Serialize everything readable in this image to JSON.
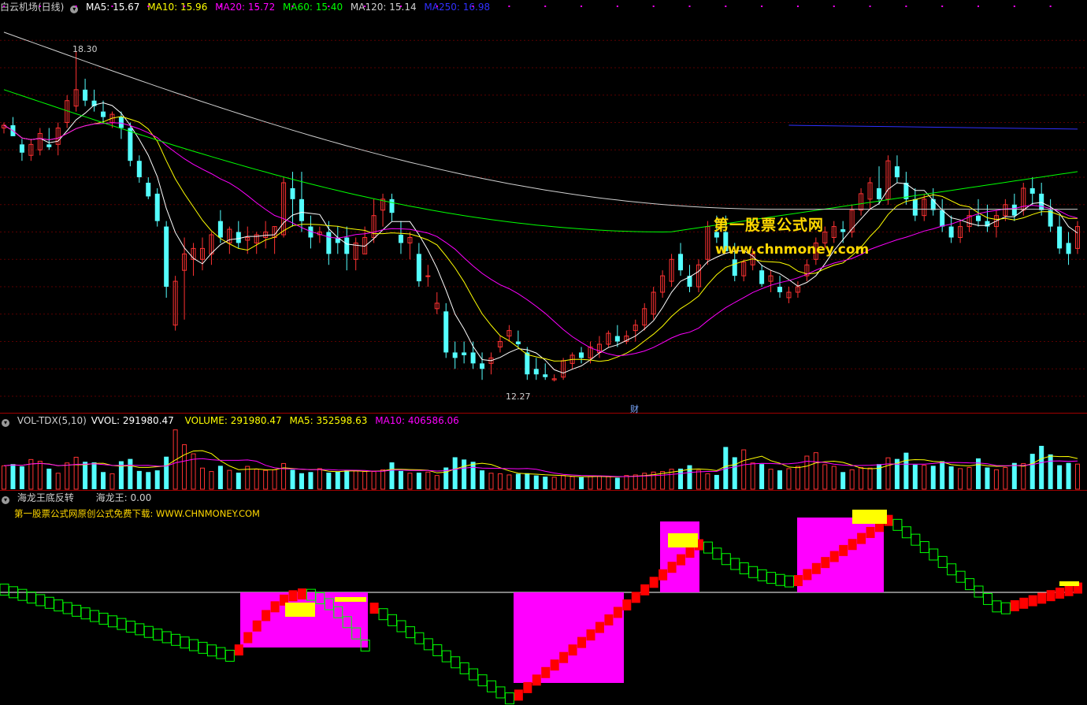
{
  "main_header": {
    "title": "白云机场(日线)",
    "ma5": "MA5: 15.67",
    "ma10": "MA10: 15.96",
    "ma20": "MA20: 15.72",
    "ma60": "MA60: 15.40",
    "ma120": "MA120: 15.14",
    "ma250": "MA250: 16.98"
  },
  "vol_header": {
    "name": "VOL-TDX(5,10)",
    "vvol": "VVOL: 291980.47",
    "volume": "VOLUME: 291980.47",
    "ma5": "MA5: 352598.63",
    "ma10": "MA10: 406586.06"
  },
  "ind_header": {
    "name": "海龙王底反转",
    "value": "海龙王: 0.00",
    "note": "第一股票公式网原创公式免费下载: WWW.CHNMONEY.COM"
  },
  "watermark": {
    "line1": "第一股票公式网",
    "line2": "www.chnmoney.com"
  },
  "annotations": {
    "high": "18.30",
    "low": "12.27",
    "finance_marker": "财"
  },
  "colors": {
    "up": "#ff3232",
    "down": "#54ffff",
    "ma5": "#ffffff",
    "ma10": "#ffff00",
    "ma20": "#ff00ff",
    "ma60": "#00ff00",
    "ma120": "#d0d0d0",
    "ma250": "#3030ff",
    "grid": "#5a0000",
    "magenta_fill": "#ff00ff",
    "red_fill": "#ff0000",
    "yellow_fill": "#ffff00",
    "green_box": "#00ff00"
  },
  "chart_data": [
    {
      "type": "candlestick",
      "title": "白云机场(日线)",
      "ylim": [
        11.9,
        18.95
      ],
      "annotations": [
        {
          "label": "18.30",
          "value": 18.3
        },
        {
          "label": "12.27",
          "value": 12.27
        }
      ],
      "candles_ohlc": [
        [
          16.9,
          17.0,
          16.8,
          16.95
        ],
        [
          16.95,
          17.1,
          16.8,
          16.75
        ],
        [
          16.6,
          16.7,
          16.3,
          16.45
        ],
        [
          16.4,
          16.7,
          16.3,
          16.6
        ],
        [
          16.5,
          16.9,
          16.4,
          16.8
        ],
        [
          16.6,
          16.9,
          16.5,
          16.55
        ],
        [
          16.6,
          17.0,
          16.4,
          16.9
        ],
        [
          17.0,
          17.5,
          16.9,
          17.4
        ],
        [
          17.3,
          18.3,
          17.2,
          17.6
        ],
        [
          17.6,
          17.8,
          17.3,
          17.4
        ],
        [
          17.4,
          17.6,
          17.2,
          17.3
        ],
        [
          17.2,
          17.4,
          17.0,
          17.1
        ],
        [
          17.0,
          17.2,
          16.9,
          17.15
        ],
        [
          17.1,
          17.2,
          16.7,
          16.9
        ],
        [
          16.9,
          17.0,
          16.2,
          16.3
        ],
        [
          16.3,
          16.4,
          15.9,
          16.0
        ],
        [
          15.9,
          16.0,
          15.6,
          15.65
        ],
        [
          15.7,
          15.8,
          15.1,
          15.2
        ],
        [
          15.1,
          15.2,
          13.8,
          14.0
        ],
        [
          13.3,
          14.2,
          13.2,
          14.1
        ],
        [
          14.3,
          14.9,
          13.4,
          14.6
        ],
        [
          14.5,
          14.8,
          14.2,
          14.7
        ],
        [
          14.5,
          14.9,
          14.3,
          14.7
        ],
        [
          14.6,
          15.0,
          14.4,
          14.95
        ],
        [
          15.2,
          15.4,
          14.8,
          14.9
        ],
        [
          14.8,
          15.1,
          14.6,
          15.05
        ],
        [
          15.0,
          15.2,
          14.7,
          14.8
        ],
        [
          14.85,
          15.1,
          14.6,
          14.9
        ],
        [
          14.8,
          15.0,
          14.6,
          14.95
        ],
        [
          14.9,
          15.2,
          14.7,
          15.0
        ],
        [
          14.9,
          15.1,
          14.6,
          15.1
        ],
        [
          14.95,
          16.0,
          14.9,
          15.9
        ],
        [
          15.8,
          16.1,
          15.1,
          15.6
        ],
        [
          15.6,
          16.1,
          15.0,
          15.2
        ],
        [
          15.1,
          15.3,
          14.7,
          14.9
        ],
        [
          14.95,
          15.1,
          14.8,
          15.0
        ],
        [
          15.0,
          15.2,
          14.4,
          14.6
        ],
        [
          14.9,
          15.1,
          14.6,
          14.8
        ],
        [
          14.9,
          15.1,
          14.3,
          14.6
        ],
        [
          14.5,
          14.9,
          14.3,
          14.8
        ],
        [
          14.6,
          15.1,
          14.6,
          14.9
        ],
        [
          14.9,
          15.6,
          14.8,
          15.3
        ],
        [
          15.4,
          15.7,
          15.1,
          15.6
        ],
        [
          15.6,
          15.7,
          15.2,
          15.35
        ],
        [
          14.95,
          15.2,
          14.6,
          14.8
        ],
        [
          14.8,
          15.0,
          14.5,
          14.9
        ],
        [
          14.6,
          14.8,
          14.0,
          14.1
        ],
        [
          14.2,
          14.4,
          14.0,
          14.2
        ],
        [
          13.6,
          13.9,
          13.5,
          13.7
        ],
        [
          13.55,
          13.7,
          12.7,
          12.8
        ],
        [
          12.8,
          13.0,
          12.5,
          12.7
        ],
        [
          12.8,
          13.0,
          12.6,
          12.75
        ],
        [
          12.8,
          13.0,
          12.5,
          12.6
        ],
        [
          12.6,
          12.8,
          12.3,
          12.5
        ],
        [
          12.6,
          12.8,
          12.4,
          12.7
        ],
        [
          12.9,
          13.1,
          12.8,
          13.0
        ],
        [
          13.1,
          13.3,
          13.0,
          13.2
        ],
        [
          13.0,
          13.2,
          12.9,
          12.95
        ],
        [
          12.8,
          12.9,
          12.3,
          12.4
        ],
        [
          12.5,
          12.7,
          12.3,
          12.4
        ],
        [
          12.4,
          12.6,
          12.3,
          12.35
        ],
        [
          12.3,
          12.4,
          12.27,
          12.32
        ],
        [
          12.35,
          12.7,
          12.3,
          12.65
        ],
        [
          12.6,
          12.8,
          12.5,
          12.75
        ],
        [
          12.8,
          12.9,
          12.6,
          12.7
        ],
        [
          12.7,
          13.0,
          12.6,
          12.9
        ],
        [
          12.8,
          13.1,
          12.7,
          12.95
        ],
        [
          12.95,
          13.2,
          12.9,
          13.15
        ],
        [
          13.1,
          13.3,
          12.9,
          13.0
        ],
        [
          13.0,
          13.2,
          12.95,
          13.1
        ],
        [
          13.2,
          13.4,
          13.0,
          13.3
        ],
        [
          13.3,
          13.7,
          13.2,
          13.6
        ],
        [
          13.5,
          14.0,
          13.4,
          13.9
        ],
        [
          13.9,
          14.3,
          13.8,
          14.2
        ],
        [
          14.1,
          14.6,
          14.0,
          14.5
        ],
        [
          14.6,
          14.8,
          14.2,
          14.3
        ],
        [
          14.2,
          14.4,
          13.9,
          14.0
        ],
        [
          14.0,
          14.5,
          13.9,
          14.4
        ],
        [
          14.5,
          15.2,
          14.4,
          15.1
        ],
        [
          15.0,
          15.3,
          14.8,
          14.9
        ],
        [
          15.0,
          15.3,
          14.8,
          14.65
        ],
        [
          14.5,
          14.8,
          14.1,
          14.2
        ],
        [
          14.2,
          14.5,
          14.1,
          14.45
        ],
        [
          14.4,
          14.7,
          14.3,
          14.6
        ],
        [
          14.3,
          14.4,
          14.0,
          14.05
        ],
        [
          14.1,
          14.3,
          13.9,
          14.2
        ],
        [
          14.0,
          14.2,
          13.8,
          13.9
        ],
        [
          13.8,
          14.0,
          13.7,
          13.9
        ],
        [
          13.9,
          14.1,
          13.8,
          14.0
        ],
        [
          14.2,
          14.5,
          14.1,
          14.4
        ],
        [
          14.5,
          14.9,
          14.4,
          14.8
        ],
        [
          14.8,
          15.1,
          14.7,
          15.0
        ],
        [
          14.9,
          15.2,
          14.8,
          15.1
        ],
        [
          15.05,
          15.2,
          14.8,
          15.0
        ],
        [
          15.0,
          15.5,
          14.9,
          15.4
        ],
        [
          15.4,
          15.8,
          15.3,
          15.7
        ],
        [
          15.6,
          16.0,
          15.4,
          15.9
        ],
        [
          15.8,
          16.2,
          15.5,
          15.6
        ],
        [
          15.6,
          16.4,
          15.5,
          16.3
        ],
        [
          16.2,
          16.4,
          15.9,
          16.0
        ],
        [
          15.9,
          16.1,
          15.5,
          15.6
        ],
        [
          15.6,
          15.8,
          15.2,
          15.3
        ],
        [
          15.3,
          15.7,
          15.2,
          15.6
        ],
        [
          15.6,
          15.8,
          15.3,
          15.4
        ],
        [
          15.4,
          15.6,
          15.0,
          15.1
        ],
        [
          15.1,
          15.3,
          14.8,
          14.9
        ],
        [
          14.9,
          15.2,
          14.8,
          15.1
        ],
        [
          15.1,
          15.4,
          15.0,
          15.3
        ],
        [
          15.3,
          15.6,
          15.1,
          15.2
        ],
        [
          15.2,
          15.5,
          15.0,
          15.1
        ],
        [
          15.1,
          15.4,
          14.9,
          15.3
        ],
        [
          15.3,
          15.6,
          15.2,
          15.5
        ],
        [
          15.5,
          15.7,
          15.2,
          15.3
        ],
        [
          15.4,
          15.9,
          15.3,
          15.8
        ],
        [
          15.8,
          16.0,
          15.5,
          15.7
        ],
        [
          15.7,
          15.9,
          15.3,
          15.4
        ],
        [
          15.4,
          15.6,
          15.0,
          15.1
        ],
        [
          15.1,
          15.3,
          14.6,
          14.7
        ],
        [
          14.8,
          15.0,
          14.4,
          14.6
        ],
        [
          14.7,
          15.2,
          14.6,
          15.1
        ]
      ]
    },
    {
      "type": "bar",
      "title": "VOL-TDX(5,10)",
      "series": [
        {
          "name": "VOLUME",
          "values": [
            41,
            44,
            40,
            52,
            49,
            36,
            28,
            46,
            56,
            48,
            47,
            30,
            27,
            49,
            53,
            32,
            30,
            33,
            57,
            104,
            78,
            62,
            37,
            31,
            41,
            33,
            29,
            40,
            35,
            33,
            34,
            45,
            34,
            28,
            30,
            36,
            29,
            31,
            33,
            32,
            31,
            31,
            34,
            47,
            32,
            28,
            29,
            30,
            24,
            38,
            56,
            52,
            48,
            33,
            28,
            27,
            25,
            27,
            28,
            24,
            22,
            21,
            24,
            22,
            21,
            22,
            23,
            22,
            20,
            24,
            25,
            28,
            30,
            31,
            35,
            36,
            42,
            33,
            27,
            25,
            74,
            56,
            69,
            46,
            44,
            35,
            33,
            36,
            40,
            58,
            64,
            43,
            40,
            30,
            34,
            38,
            37,
            44,
            55,
            53,
            64,
            43,
            42,
            41,
            49,
            40,
            36,
            38,
            54,
            38,
            34,
            38,
            46,
            45,
            62,
            76,
            61,
            42,
            46,
            44
          ]
        }
      ]
    }
  ]
}
